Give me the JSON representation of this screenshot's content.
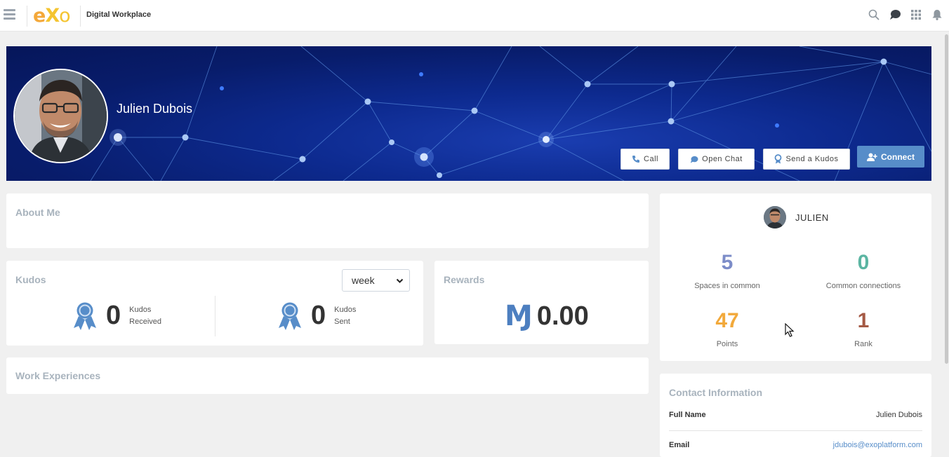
{
  "app": {
    "logo_text": "eXo",
    "workspace_name": "Digital Workplace"
  },
  "topbar_icons": [
    "menu-icon",
    "search-icon",
    "chat-icon",
    "apps-grid-icon",
    "bell-icon"
  ],
  "profile": {
    "name": "Julien Dubois",
    "actions": {
      "call": "Call",
      "open_chat": "Open Chat",
      "send_kudos": "Send a Kudos",
      "connect": "Connect"
    }
  },
  "about": {
    "title": "About Me"
  },
  "kudos": {
    "title": "Kudos",
    "period": "week",
    "received": {
      "count": "0",
      "label_line1": "Kudos",
      "label_line2": "Received"
    },
    "sent": {
      "count": "0",
      "label_line1": "Kudos",
      "label_line2": "Sent"
    }
  },
  "rewards": {
    "title": "Rewards",
    "symbol": "Ɱ",
    "amount": "0.00"
  },
  "work": {
    "title": "Work Experiences"
  },
  "stats": {
    "user_label": "JULIEN",
    "spaces": {
      "value": "5",
      "label": "Spaces in common",
      "color": "#7c8cc8"
    },
    "connections": {
      "value": "0",
      "label": "Common connections",
      "color": "#5bb5a2"
    },
    "points": {
      "value": "47",
      "label": "Points",
      "color": "#f2a93b"
    },
    "rank": {
      "value": "1",
      "label": "Rank",
      "color": "#a55a45"
    }
  },
  "contact": {
    "title": "Contact Information",
    "full_name_label": "Full Name",
    "full_name": "Julien Dubois",
    "email_label": "Email",
    "email": "jdubois@exoplatform.com"
  },
  "colors": {
    "accent": "#578dc9",
    "banner": "#0d2a8f",
    "card_title": "#a8b3bd"
  }
}
